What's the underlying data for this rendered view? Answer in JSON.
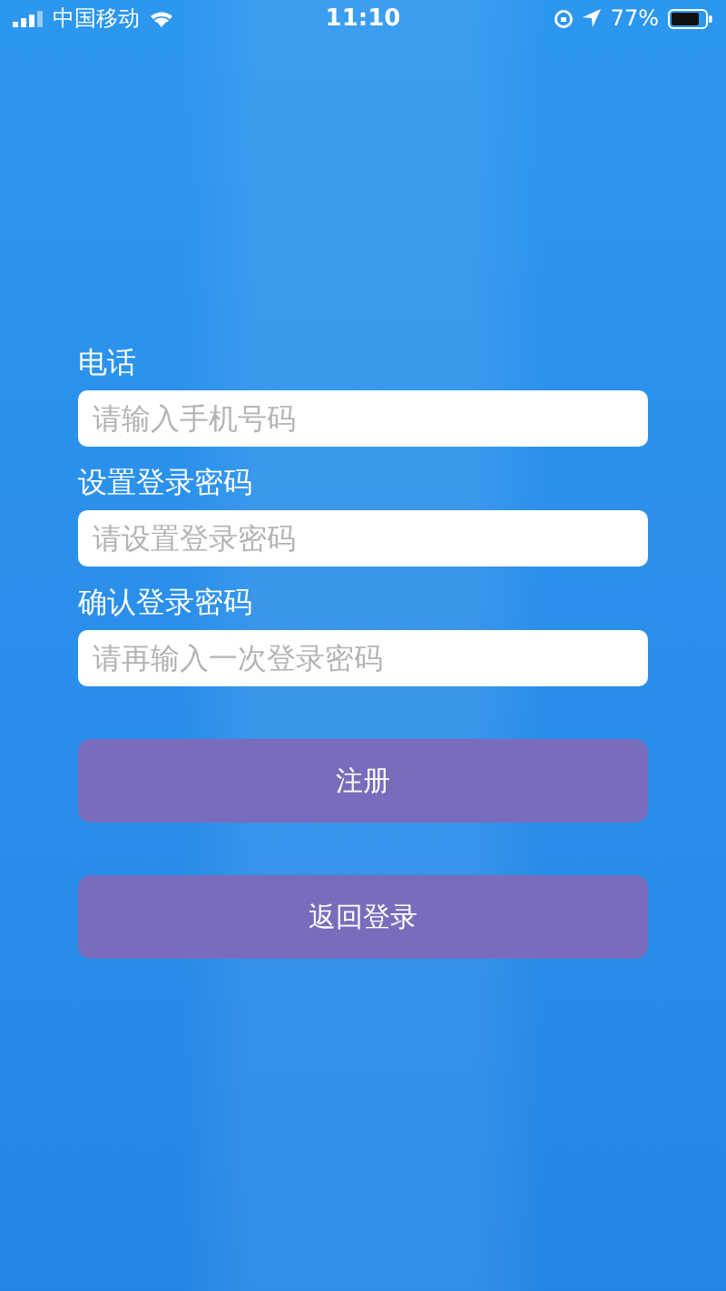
{
  "status_bar": {
    "carrier": "中国移动",
    "time": "11:10",
    "battery": "77%"
  },
  "fields": [
    {
      "label": "电话",
      "placeholder": "请输入手机号码"
    },
    {
      "label": "设置登录密码",
      "placeholder": "请设置登录密码"
    },
    {
      "label": "确认登录密码",
      "placeholder": "请再输入一次登录密码"
    }
  ],
  "buttons": [
    "注册",
    "返回登录"
  ]
}
